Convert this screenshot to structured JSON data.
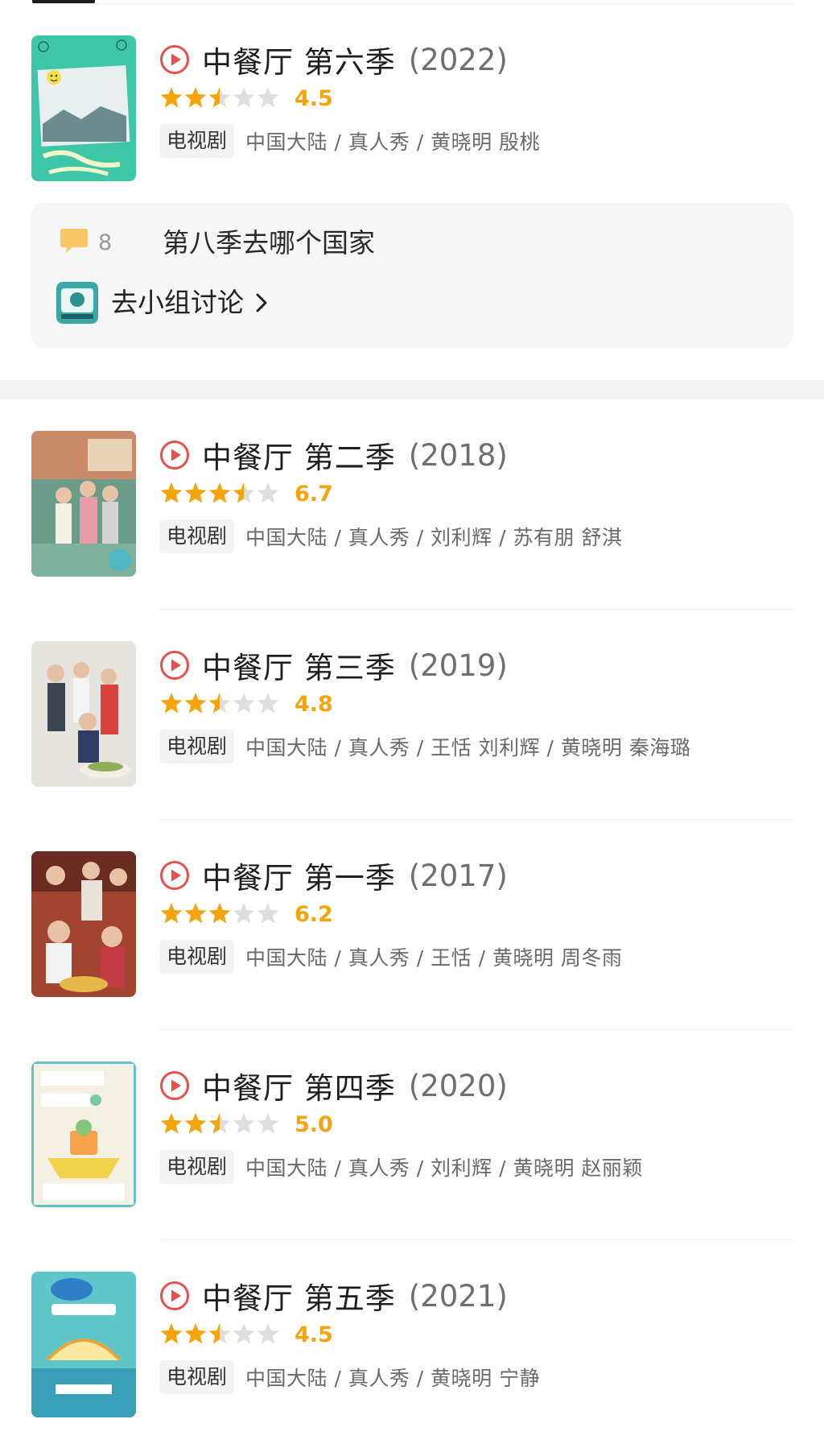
{
  "colors": {
    "star": "#f5a50b",
    "star_empty": "#dedede",
    "play": "#e8504d",
    "tag_bg": "#f3f3f3"
  },
  "shows": [
    {
      "title": "中餐厅 第六季",
      "year": "(2022)",
      "rating_stars": 2.5,
      "score": "4.5",
      "tag": "电视剧",
      "meta": "中国大陆 / 真人秀 / 黄晓明 殷桃",
      "poster": "poster-season-6"
    },
    {
      "title": "中餐厅 第二季",
      "year": "(2018)",
      "rating_stars": 3.5,
      "score": "6.7",
      "tag": "电视剧",
      "meta": "中国大陆 / 真人秀 / 刘利辉 / 苏有朋 舒淇",
      "poster": "poster-season-2"
    },
    {
      "title": "中餐厅 第三季",
      "year": "(2019)",
      "rating_stars": 2.5,
      "score": "4.8",
      "tag": "电视剧",
      "meta": "中国大陆 / 真人秀 / 王恬 刘利辉 / 黄晓明 秦海璐",
      "poster": "poster-season-3"
    },
    {
      "title": "中餐厅 第一季",
      "year": "(2017)",
      "rating_stars": 3,
      "score": "6.2",
      "tag": "电视剧",
      "meta": "中国大陆 / 真人秀 / 王恬 / 黄晓明 周冬雨",
      "poster": "poster-season-1"
    },
    {
      "title": "中餐厅 第四季",
      "year": "(2020)",
      "rating_stars": 2.5,
      "score": "5.0",
      "tag": "电视剧",
      "meta": "中国大陆 / 真人秀 / 刘利辉 / 黄晓明 赵丽颖",
      "poster": "poster-season-4"
    },
    {
      "title": "中餐厅 第五季",
      "year": "(2021)",
      "rating_stars": 2.5,
      "score": "4.5",
      "tag": "电视剧",
      "meta": "中国大陆 / 真人秀 / 黄晓明 宁静",
      "poster": "poster-season-5"
    }
  ],
  "discussion": {
    "comment_count": "8",
    "topic": "第八季去哪个国家",
    "group_link": "去小组讨论",
    "icons": {
      "comment": "speech-bubble-icon",
      "chevron": "chevron-right-icon"
    }
  },
  "icons": {
    "play": "play-circle-icon",
    "star": "star-icon"
  }
}
